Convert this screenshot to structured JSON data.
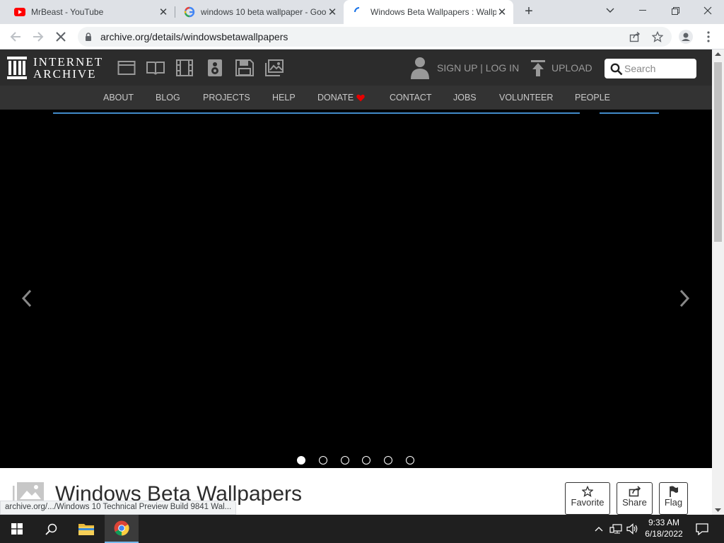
{
  "browser": {
    "tabs": [
      {
        "title": "MrBeast - YouTube",
        "favicon": "youtube-icon",
        "active": false
      },
      {
        "title": "windows 10 beta wallpaper - Goo",
        "favicon": "google-icon",
        "active": false
      },
      {
        "title": "Windows Beta Wallpapers : Wallp",
        "favicon": "loading-spinner-icon",
        "active": true
      }
    ],
    "new_tab_label": "+",
    "url": "archive.org/details/windowsbetawallpapers"
  },
  "ia": {
    "logo_line1": "INTERNET",
    "logo_line2": "ARCHIVE",
    "media_icons": [
      "web-icon",
      "texts-icon",
      "video-icon",
      "audio-icon",
      "software-icon",
      "images-icon"
    ],
    "signup_label": "SIGN UP | LOG IN",
    "upload_label": "UPLOAD",
    "search_placeholder": "Search",
    "nav": [
      "ABOUT",
      "BLOG",
      "PROJECTS",
      "HELP",
      "DONATE",
      "CONTACT",
      "JOBS",
      "VOLUNTEER",
      "PEOPLE"
    ]
  },
  "carousel": {
    "prev_icon": "chevron-left-icon",
    "next_icon": "chevron-right-icon",
    "dot_count": 6,
    "active_dot": 0
  },
  "item": {
    "title": "Windows Beta Wallpapers",
    "actions": [
      "Favorite",
      "Share",
      "Flag"
    ]
  },
  "status_url": "archive.org/.../Windows 10 Technical Preview Build 9841 Wal...",
  "taskbar": {
    "time": "9:33 AM",
    "date": "6/18/2022"
  },
  "colors": {
    "accent_blue": "#428bca",
    "donate_heart": "#e60000"
  }
}
